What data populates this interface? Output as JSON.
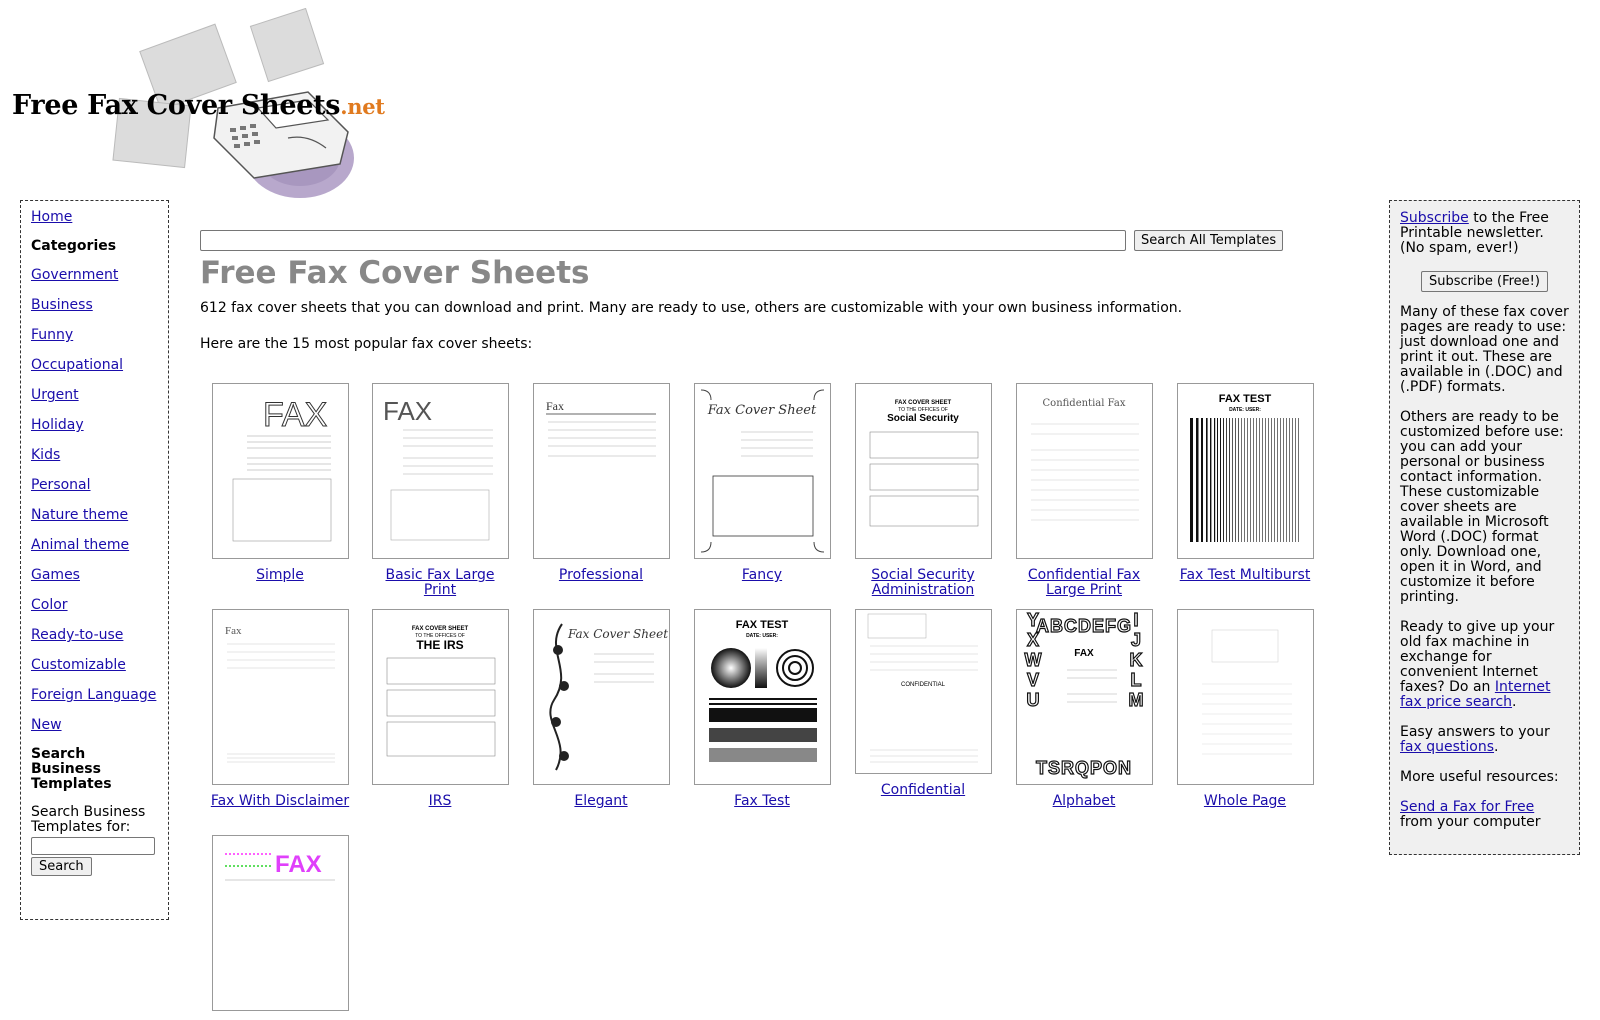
{
  "logo": {
    "name": "Free Fax Cover Sheets",
    "tld": ".net"
  },
  "left_nav": {
    "home": "Home",
    "categories_heading": "Categories",
    "categories": [
      "Government",
      "Business",
      "Funny",
      "Occupational",
      "Urgent",
      "Holiday",
      "Kids",
      "Personal",
      "Nature theme",
      "Animal theme",
      "Games",
      "Color",
      "Ready-to-use",
      "Customizable",
      "Foreign Language",
      "New"
    ],
    "biz_heading": "Search Business Templates",
    "biz_label": "Search Business Templates for:",
    "biz_value": "",
    "biz_button": "Search"
  },
  "search": {
    "value": "",
    "button": "Search All Templates"
  },
  "main": {
    "title": "Free Fax Cover Sheets",
    "intro": "612 fax cover sheets that you can download and print. Many are ready to use, others are customizable with your own business information.",
    "popular": "Here are the 15 most popular fax cover sheets:"
  },
  "tiles": [
    {
      "caption": "Simple"
    },
    {
      "caption": "Basic Fax Large Print"
    },
    {
      "caption": "Professional"
    },
    {
      "caption": "Fancy"
    },
    {
      "caption": "Social Security Administration"
    },
    {
      "caption": "Confidential Fax Large Print"
    },
    {
      "caption": "Fax Test Multiburst"
    },
    {
      "caption": "Fax With Disclaimer"
    },
    {
      "caption": "IRS"
    },
    {
      "caption": "Elegant"
    },
    {
      "caption": "Fax Test"
    },
    {
      "caption": "Confidential"
    },
    {
      "caption": "Alphabet"
    },
    {
      "caption": "Whole Page"
    },
    {
      "caption": ""
    }
  ],
  "thumb_text": {
    "fax": "FAX",
    "fax_small": "Fax",
    "fancy_title": "Fax Cover Sheet",
    "ssa_head": "FAX COVER SHEET",
    "ssa_sub": "TO THE OFFICES OF",
    "ssa_title": "Social Security",
    "irs_title": "THE IRS",
    "conf_title": "Confidential Fax",
    "fax_test": "FAX TEST",
    "date_user": "DATE:          USER:",
    "confidential": "CONFIDENTIAL",
    "alphabet_top": "ABCDEFG",
    "alphabet_bottom": "TSRQPON",
    "alphabet_left": "ZYXWVU",
    "alphabet_right": "HIJKLM"
  },
  "right_sidebar": {
    "subscribe_link": "Subscribe",
    "subscribe_text": " to the Free Printable newsletter. (No spam, ever!)",
    "subscribe_button": "Subscribe (Free!)",
    "p1": "Many of these fax cover pages are ready to use: just download one and print it out. These are available in (.DOC) and (.PDF) formats.",
    "p2": "Others are ready to be customized before use: you can add your personal or business contact information. These customizable cover sheets are available in Microsoft Word (.DOC) format only. Download one, open it in Word, and customize it before printing.",
    "p3_before": "Ready to give up your old fax machine in exchange for convenient Internet faxes? Do an ",
    "p3_link": "Internet fax price search",
    "p3_after": ".",
    "p4_before": "Easy answers to your ",
    "p4_link": "fax questions",
    "p4_after": ".",
    "p5": "More useful resources:",
    "p6_link": "Send a Fax for Free",
    "p6_after": " from your computer"
  },
  "colors": {
    "link": "#1a0dab",
    "title_gray": "#888888",
    "sidebar_bg": "#f0f0f0",
    "logo_accent": "#e07a1f"
  }
}
